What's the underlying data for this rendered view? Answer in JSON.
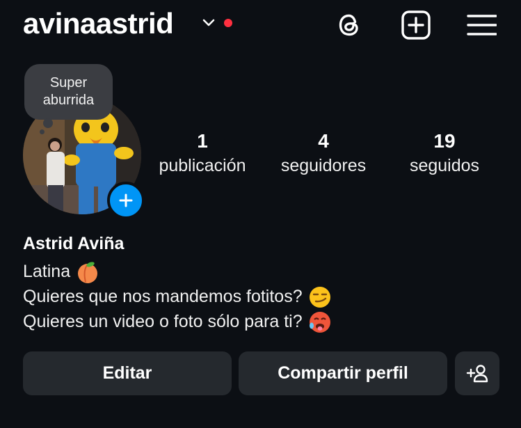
{
  "header": {
    "username": "avinaastrid",
    "icons": [
      "chevron-down-icon",
      "notification-dot",
      "threads-icon",
      "create-plus-icon",
      "menu-icon"
    ],
    "dot_color": "#ff3040"
  },
  "profile": {
    "note": "Super aburrida",
    "add_story_icon": "plus-icon",
    "accent_color": "#0095f6"
  },
  "stats": [
    {
      "value": "1",
      "label": "publicación"
    },
    {
      "value": "4",
      "label": "seguidores"
    },
    {
      "value": "19",
      "label": "seguidos"
    }
  ],
  "bio": {
    "name": "Astrid Aviña",
    "lines": [
      {
        "text": "Latina",
        "emoji": "peach-emoji"
      },
      {
        "text": "Quieres que nos mandemos fotitos?",
        "emoji": "smirk-emoji"
      },
      {
        "text": "Quieres un video o foto sólo para ti?",
        "emoji": "hot-face-emoji"
      }
    ]
  },
  "actions": {
    "edit_label": "Editar",
    "share_label": "Compartir perfil",
    "add_person_icon": "add-person-icon"
  }
}
